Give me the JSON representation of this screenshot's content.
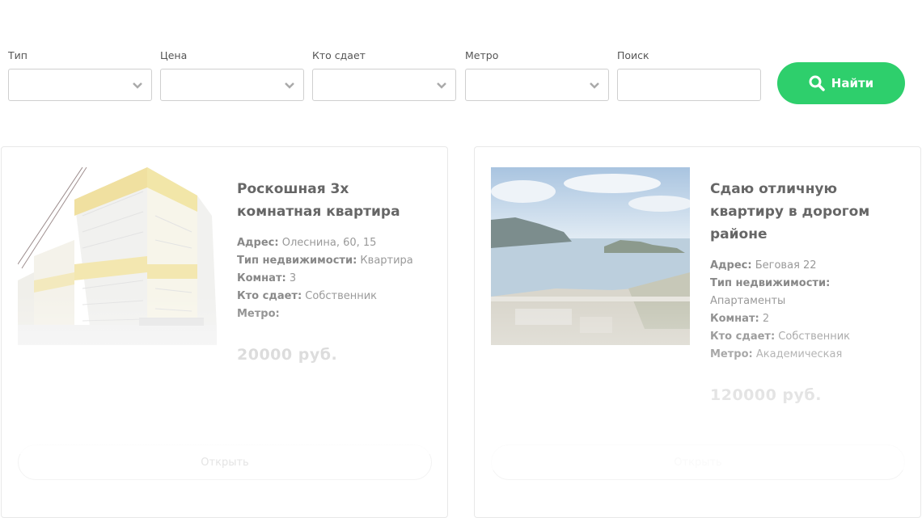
{
  "filters": {
    "type_label": "Тип",
    "price_label": "Цена",
    "owner_label": "Кто сдает",
    "metro_label": "Метро",
    "search_label": "Поиск",
    "search_value": "",
    "find_button": "Найти"
  },
  "colors": {
    "accent": "#2ecf6c"
  },
  "listings": [
    {
      "title": "Роскошная 3х комнатная квартира",
      "address_label": "Адрес:",
      "address": "Олеснина, 60, 15",
      "type_label": "Тип недвижимости:",
      "type": "Квартира",
      "rooms_label": "Комнат:",
      "rooms": "3",
      "owner_label": "Кто сдает:",
      "owner": "Собственник",
      "metro_label": "Метро:",
      "metro": "",
      "price": "20000 руб.",
      "open_button": "Открыть"
    },
    {
      "title": "Сдаю отличную квартиру в дорогом районе",
      "address_label": "Адрес:",
      "address": "Беговая 22",
      "type_label": "Тип недвижимости:",
      "type": "Апартаменты",
      "rooms_label": "Комнат:",
      "rooms": "2",
      "owner_label": "Кто сдает:",
      "owner": "Собственник",
      "metro_label": "Метро:",
      "metro": "Академическая",
      "price": "120000 руб.",
      "open_button": "Открыть"
    }
  ]
}
